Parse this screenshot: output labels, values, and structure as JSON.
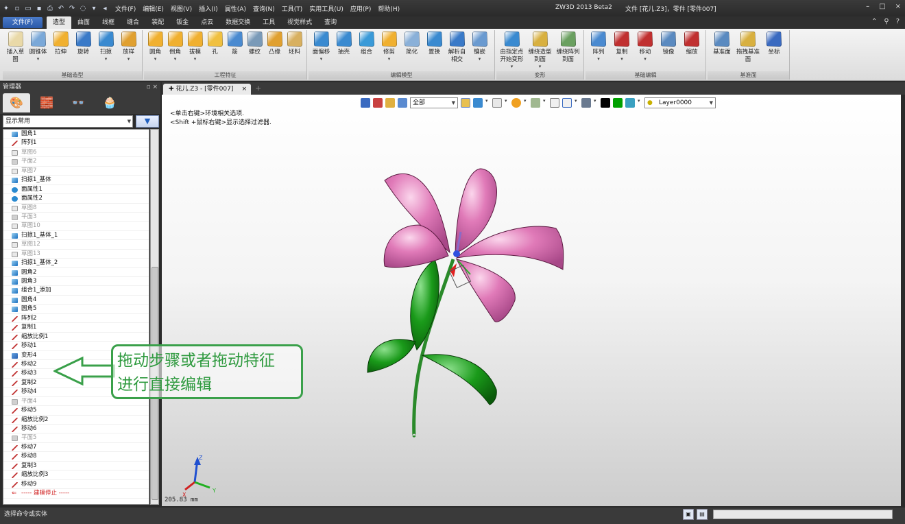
{
  "titlebar": {
    "quick_icons": [
      "new-icon",
      "open-icon",
      "save-icon",
      "print-icon",
      "undo-icon",
      "redo-icon",
      "loop-icon",
      "dropdown-icon",
      "back-icon"
    ],
    "menu": [
      "文件(F)",
      "编辑(E)",
      "视图(V)",
      "插入(I)",
      "属性(A)",
      "查询(N)",
      "工具(T)",
      "实用工具(U)",
      "应用(P)",
      "帮助(H)"
    ],
    "app_title": "ZW3D 2013 Beta2",
    "doc_title": "文件 [花儿.Z3]，零件 [零件007]",
    "win_buttons": [
      "–",
      "□",
      "×"
    ]
  },
  "tabrow": {
    "file_label": "文件(F)",
    "tabs": [
      "造型",
      "曲面",
      "线框",
      "缝合",
      "装配",
      "钣金",
      "点云",
      "数据交换",
      "工具",
      "视觉样式",
      "查询"
    ],
    "active_tab": "造型"
  },
  "ribbon": {
    "groups": [
      {
        "label": "基础造型",
        "tools": [
          {
            "label": "插入草图",
            "color": "#e9d9a8"
          },
          {
            "label": "圆锥体",
            "color": "#7aa8d8",
            "arrow": true
          },
          {
            "label": "拉伸",
            "color": "#f0b030"
          },
          {
            "label": "旋转",
            "color": "#3a7ac8"
          },
          {
            "label": "扫掠",
            "color": "#3a8ad0",
            "arrow": true
          },
          {
            "label": "放样",
            "color": "#e0a030",
            "arrow": true
          }
        ]
      },
      {
        "label": "工程特征",
        "tools": [
          {
            "label": "圆角",
            "color": "#f0b030",
            "arrow": true
          },
          {
            "label": "倒角",
            "color": "#f0b030",
            "arrow": true
          },
          {
            "label": "拔模",
            "color": "#f0b030",
            "arrow": true
          },
          {
            "label": "孔",
            "color": "#f0c040"
          },
          {
            "label": "筋",
            "color": "#4a8ad0"
          },
          {
            "label": "螺纹",
            "color": "#7a9ab8"
          },
          {
            "label": "凸缘",
            "color": "#e0a030"
          },
          {
            "label": "坯料",
            "color": "#d8b060"
          }
        ]
      },
      {
        "label": "编辑模型",
        "tools": [
          {
            "label": "面偏移",
            "color": "#3a8ad0",
            "arrow": true
          },
          {
            "label": "抽壳",
            "color": "#3a8ad0"
          },
          {
            "label": "组合",
            "color": "#3a9ad8"
          },
          {
            "label": "修剪",
            "color": "#f0b030",
            "arrow": true
          },
          {
            "label": "简化",
            "color": "#8ab0d8"
          },
          {
            "label": "置换",
            "color": "#3a8ad0"
          },
          {
            "label": "解析自相交",
            "color": "#3a7ac8"
          },
          {
            "label": "镶嵌",
            "color": "#6a9ad0",
            "arrow": true
          }
        ]
      },
      {
        "label": "变形",
        "tools": [
          {
            "label": "由指定点开始变形",
            "color": "#3a8ad0",
            "arrow": true
          },
          {
            "label": "缠绕造型到面",
            "color": "#d8b040",
            "arrow": true
          },
          {
            "label": "缠绕阵列到面",
            "color": "#6aa060"
          }
        ]
      },
      {
        "label": "基础编辑",
        "tools": [
          {
            "label": "阵列",
            "color": "#4a8ad0",
            "arrow": true
          },
          {
            "label": "复制",
            "color": "#c03030",
            "arrow": true
          },
          {
            "label": "移动",
            "color": "#c03030",
            "arrow": true
          },
          {
            "label": "镜像",
            "color": "#5a8ac0"
          },
          {
            "label": "缩放",
            "color": "#c03030"
          }
        ]
      },
      {
        "label": "基准面",
        "tools": [
          {
            "label": "基准面",
            "color": "#5a8ac0"
          },
          {
            "label": "拖拽基准面",
            "color": "#d8b040"
          },
          {
            "label": "坐标",
            "color": "#3a6ac0"
          }
        ]
      }
    ]
  },
  "manager": {
    "title": "管理器",
    "controls": "▫ ×",
    "tabs": [
      "palette-icon",
      "history-icon",
      "glasses-icon",
      "cake-icon"
    ],
    "filter_value": "显示常用",
    "filter_icon": "▼",
    "items": [
      {
        "label": "圆角1",
        "icon": "solid",
        "gray": false
      },
      {
        "label": "阵列1",
        "icon": "line",
        "gray": false
      },
      {
        "label": "草图6",
        "icon": "sketch",
        "gray": true
      },
      {
        "label": "平面2",
        "icon": "plane",
        "gray": true
      },
      {
        "label": "草图7",
        "icon": "sketch",
        "gray": true
      },
      {
        "label": "扫掠1_基体",
        "icon": "solid",
        "gray": false
      },
      {
        "label": "面属性1",
        "icon": "face",
        "gray": false
      },
      {
        "label": "面属性2",
        "icon": "face",
        "gray": false
      },
      {
        "label": "草图8",
        "icon": "sketch",
        "gray": true
      },
      {
        "label": "平面3",
        "icon": "plane",
        "gray": true
      },
      {
        "label": "草图10",
        "icon": "sketch",
        "gray": true
      },
      {
        "label": "扫掠1_基体_1",
        "icon": "solid",
        "gray": false
      },
      {
        "label": "草图12",
        "icon": "sketch",
        "gray": true
      },
      {
        "label": "草图13",
        "icon": "sketch",
        "gray": true
      },
      {
        "label": "扫掠1_基体_2",
        "icon": "solid",
        "gray": false
      },
      {
        "label": "圆角2",
        "icon": "solid",
        "gray": false
      },
      {
        "label": "圆角3",
        "icon": "solid",
        "gray": false
      },
      {
        "label": "组合1_添加",
        "icon": "solid",
        "gray": false
      },
      {
        "label": "圆角4",
        "icon": "solid",
        "gray": false
      },
      {
        "label": "圆角5",
        "icon": "solid",
        "gray": false
      },
      {
        "label": "阵列2",
        "icon": "line",
        "gray": false
      },
      {
        "label": "复制1",
        "icon": "line",
        "gray": false
      },
      {
        "label": "缩放比例1",
        "icon": "line",
        "gray": false
      },
      {
        "label": "移动1",
        "icon": "line",
        "gray": false
      },
      {
        "label": "变形4",
        "icon": "morph",
        "gray": false
      },
      {
        "label": "移动2",
        "icon": "line",
        "gray": false
      },
      {
        "label": "移动3",
        "icon": "line",
        "gray": false
      },
      {
        "label": "复制2",
        "icon": "line",
        "gray": false
      },
      {
        "label": "移动4",
        "icon": "line",
        "gray": false
      },
      {
        "label": "平面4",
        "icon": "plane",
        "gray": true
      },
      {
        "label": "移动5",
        "icon": "line",
        "gray": false
      },
      {
        "label": "缩放比例2",
        "icon": "line",
        "gray": false
      },
      {
        "label": "移动6",
        "icon": "line",
        "gray": false
      },
      {
        "label": "平面5",
        "icon": "plane",
        "gray": true
      },
      {
        "label": "移动7",
        "icon": "line",
        "gray": false
      },
      {
        "label": "移动8",
        "icon": "line",
        "gray": false
      },
      {
        "label": "复制3",
        "icon": "line",
        "gray": false
      },
      {
        "label": "缩放比例3",
        "icon": "line",
        "gray": false
      },
      {
        "label": "移动9",
        "icon": "line",
        "gray": false
      }
    ],
    "stop_label": "----- 建模停止 -----"
  },
  "doc": {
    "tab_label": "✚ 花儿.Z3 - [零件007]",
    "close": "×",
    "new_tab": "+"
  },
  "viewport": {
    "filter_all": "全部",
    "layer": "Layer0000",
    "hint1": "<单击右键>环境相关选项.",
    "hint2": "<Shift +鼠标右键>显示选择过滤器.",
    "coord": "205.83 mm",
    "axis_labels": {
      "x": "X",
      "y": "Y",
      "z": "Z"
    },
    "colors": {
      "petal": "#e07ab8",
      "leaf": "#1a9a1a",
      "stem": "#2a8a2a",
      "swatch1": "#000000",
      "swatch2": "#00a000"
    }
  },
  "callout": {
    "line1": "拖动步骤或者拖动特征",
    "line2": "进行直接编辑",
    "color": "#3aa04a"
  },
  "statusbar": {
    "text": "选择命令或实体"
  }
}
